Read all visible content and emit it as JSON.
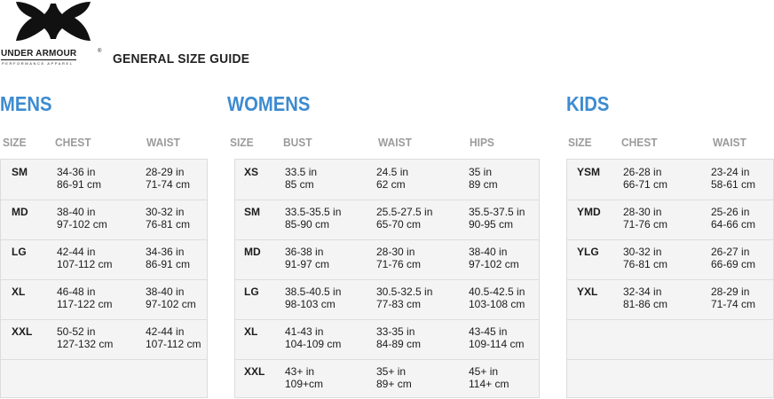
{
  "brand": {
    "name": "UNDER ARMOUR",
    "registered": "®",
    "tagline": "PERFORMANCE APPAREL"
  },
  "page_title": "GENERAL SIZE GUIDE",
  "sections": {
    "mens": {
      "title": "MENS",
      "columns": [
        "SIZE",
        "CHEST",
        "WAIST"
      ],
      "rows": [
        {
          "size": "SM",
          "values": [
            [
              "34-36 in",
              "86-91 cm"
            ],
            [
              "28-29 in",
              "71-74 cm"
            ]
          ]
        },
        {
          "size": "MD",
          "values": [
            [
              "38-40 in",
              "97-102 cm"
            ],
            [
              "30-32 in",
              "76-81 cm"
            ]
          ]
        },
        {
          "size": "LG",
          "values": [
            [
              "42-44 in",
              "107-112 cm"
            ],
            [
              "34-36 in",
              "86-91 cm"
            ]
          ]
        },
        {
          "size": "XL",
          "values": [
            [
              "46-48 in",
              "117-122 cm"
            ],
            [
              "38-40 in",
              "97-102 cm"
            ]
          ]
        },
        {
          "size": "XXL",
          "values": [
            [
              "50-52 in",
              "127-132 cm"
            ],
            [
              "42-44 in",
              "107-112 cm"
            ]
          ]
        },
        {
          "size": "",
          "values": [
            [
              "",
              ""
            ],
            [
              "",
              ""
            ]
          ]
        }
      ]
    },
    "womens": {
      "title": "WOMENS",
      "columns": [
        "SIZE",
        "BUST",
        "WAIST",
        "HIPS"
      ],
      "rows": [
        {
          "size": "XS",
          "values": [
            [
              "33.5 in",
              "85 cm"
            ],
            [
              "24.5 in",
              "62 cm"
            ],
            [
              "35 in",
              "89 cm"
            ]
          ]
        },
        {
          "size": "SM",
          "values": [
            [
              "33.5-35.5 in",
              "85-90 cm"
            ],
            [
              "25.5-27.5 in",
              "65-70 cm"
            ],
            [
              "35.5-37.5 in",
              "90-95 cm"
            ]
          ]
        },
        {
          "size": "MD",
          "values": [
            [
              "36-38 in",
              "91-97 cm"
            ],
            [
              "28-30 in",
              "71-76 cm"
            ],
            [
              "38-40 in",
              "97-102 cm"
            ]
          ]
        },
        {
          "size": "LG",
          "values": [
            [
              "38.5-40.5 in",
              "98-103 cm"
            ],
            [
              "30.5-32.5 in",
              "77-83 cm"
            ],
            [
              "40.5-42.5 in",
              "103-108 cm"
            ]
          ]
        },
        {
          "size": "XL",
          "values": [
            [
              "41-43 in",
              "104-109 cm"
            ],
            [
              "33-35 in",
              "84-89 cm"
            ],
            [
              "43-45 in",
              "109-114 cm"
            ]
          ]
        },
        {
          "size": "XXL",
          "values": [
            [
              "43+ in",
              "109+cm"
            ],
            [
              "35+ in",
              "89+ cm"
            ],
            [
              "45+ in",
              "114+ cm"
            ]
          ]
        }
      ]
    },
    "kids": {
      "title": "KIDS",
      "columns": [
        "SIZE",
        "CHEST",
        "WAIST"
      ],
      "rows": [
        {
          "size": "YSM",
          "values": [
            [
              "26-28 in",
              "66-71 cm"
            ],
            [
              "23-24 in",
              "58-61 cm"
            ]
          ]
        },
        {
          "size": "YMD",
          "values": [
            [
              "28-30 in",
              "71-76 cm"
            ],
            [
              "25-26 in",
              "64-66 cm"
            ]
          ]
        },
        {
          "size": "YLG",
          "values": [
            [
              "30-32 in",
              "76-81 cm"
            ],
            [
              "26-27 in",
              "66-69 cm"
            ]
          ]
        },
        {
          "size": "YXL",
          "values": [
            [
              "32-34 in",
              "81-86 cm"
            ],
            [
              "28-29 in",
              "71-74 cm"
            ]
          ]
        },
        {
          "size": "",
          "values": [
            [
              "",
              ""
            ],
            [
              "",
              ""
            ]
          ]
        },
        {
          "size": "",
          "values": [
            [
              "",
              ""
            ],
            [
              "",
              ""
            ]
          ]
        }
      ]
    }
  },
  "colors": {
    "section_title": "#3d8bd0",
    "column_header": "#9b9b9b",
    "table_bg": "#f4f4f4"
  }
}
